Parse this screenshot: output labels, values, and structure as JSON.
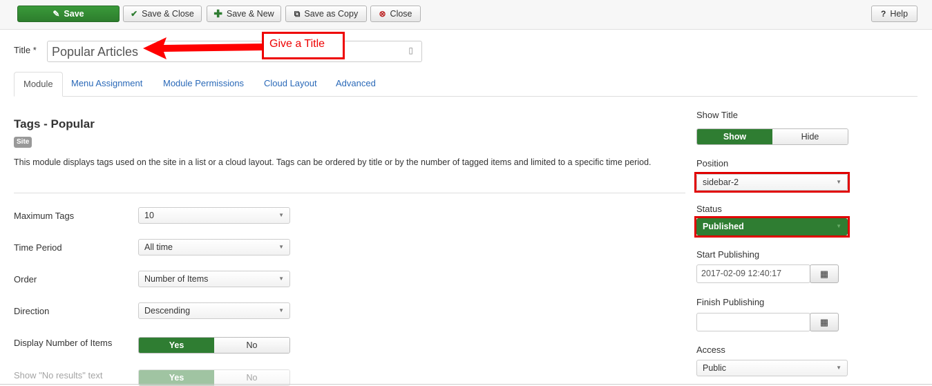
{
  "toolbar": {
    "save": "Save",
    "save_close": "Save & Close",
    "save_new": "Save & New",
    "save_copy": "Save as Copy",
    "close": "Close",
    "help": "Help"
  },
  "title": {
    "label": "Title *",
    "value": "Popular Articles"
  },
  "annotation": {
    "text": "Give a Title",
    "color": "#ff0000"
  },
  "tabs": [
    "Module",
    "Menu Assignment",
    "Module Permissions",
    "Cloud Layout",
    "Advanced"
  ],
  "module": {
    "name": "Tags - Popular",
    "badge": "Site",
    "description": "This module displays tags used on the site in a list or a cloud layout. Tags can be ordered by title or by the number of tagged items and limited to a specific time period."
  },
  "fields": [
    {
      "label": "Maximum Tags",
      "value": "10"
    },
    {
      "label": "Time Period",
      "value": "All time"
    },
    {
      "label": "Order",
      "value": "Number of Items"
    },
    {
      "label": "Direction",
      "value": "Descending"
    }
  ],
  "toggles": [
    {
      "label": "Display Number of Items",
      "yes": "Yes",
      "no": "No",
      "selected": "Yes"
    },
    {
      "label": "Show \"No results\" text",
      "yes": "Yes",
      "no": "No",
      "selected": "Yes"
    }
  ],
  "side": {
    "show_title": {
      "label": "Show Title",
      "show": "Show",
      "hide": "Hide",
      "selected": "Show"
    },
    "position": {
      "label": "Position",
      "value": "sidebar-2"
    },
    "status": {
      "label": "Status",
      "value": "Published",
      "color": "#2f7d32"
    },
    "start": {
      "label": "Start Publishing",
      "value": "2017-02-09 12:40:17"
    },
    "finish": {
      "label": "Finish Publishing",
      "value": ""
    },
    "access": {
      "label": "Access",
      "value": "Public"
    }
  }
}
